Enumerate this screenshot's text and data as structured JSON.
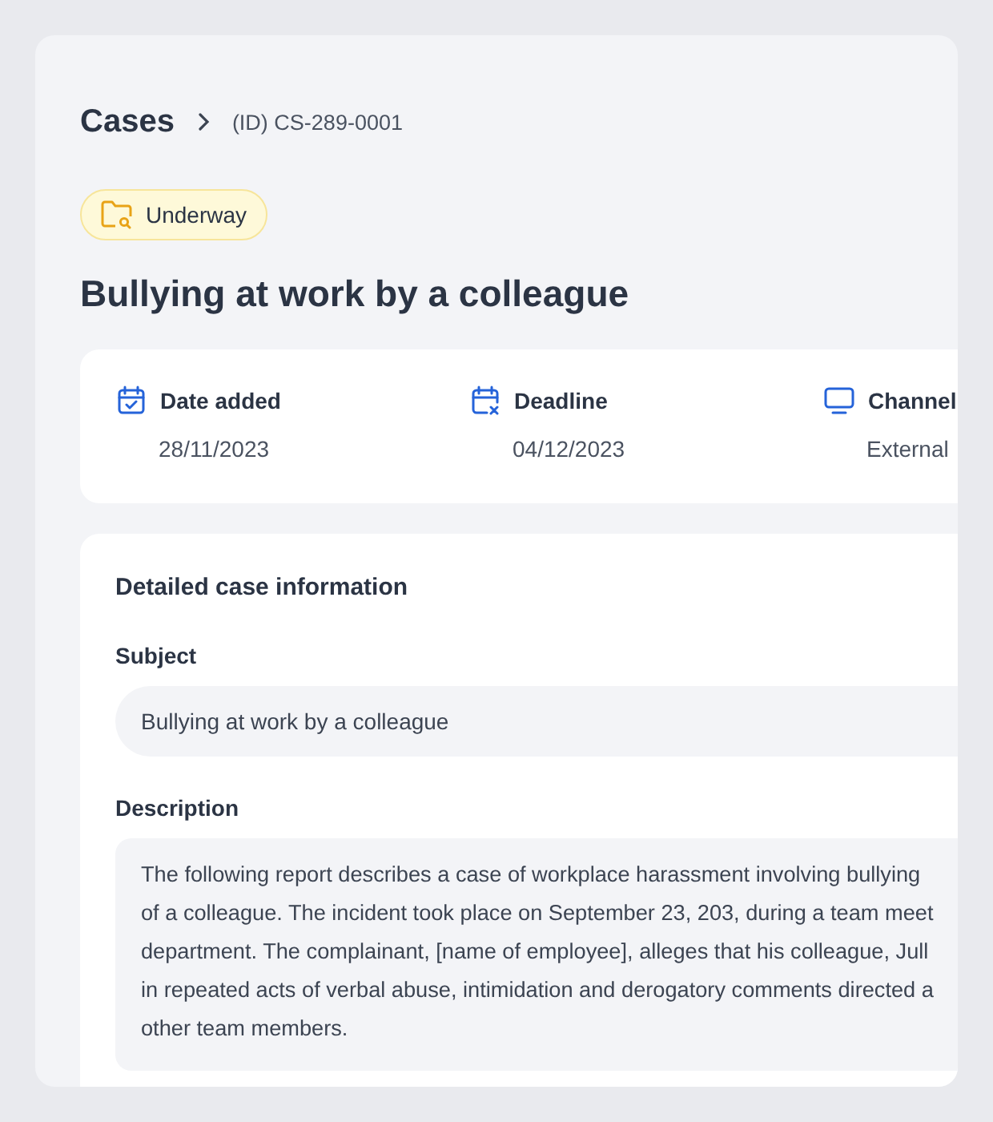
{
  "breadcrumb": {
    "root": "Cases",
    "current": "(ID) CS-289-0001"
  },
  "status": {
    "kind": "underway",
    "label": "Underway"
  },
  "title": "Bullying at work by a colleague",
  "meta": [
    {
      "kind": "date-added",
      "label": "Date added",
      "value": "28/11/2023"
    },
    {
      "kind": "deadline",
      "label": "Deadline",
      "value": "04/12/2023"
    },
    {
      "kind": "channel",
      "label": "Channel",
      "value": "External"
    }
  ],
  "details": {
    "heading": "Detailed case information",
    "fields": [
      {
        "kind": "single-line",
        "label": "Subject",
        "value": "Bullying at work by a colleague"
      },
      {
        "kind": "multi-line",
        "label": "Description",
        "lines": [
          "The following report describes a case of workplace harassment involving bullying",
          "of a colleague. The incident took place on September 23, 203, during a team meet",
          "department. The complainant, [name of employee], alleges that his colleague, Jull",
          "in repeated acts of verbal abuse, intimidation and derogatory comments directed a",
          "other team members."
        ]
      }
    ]
  }
}
